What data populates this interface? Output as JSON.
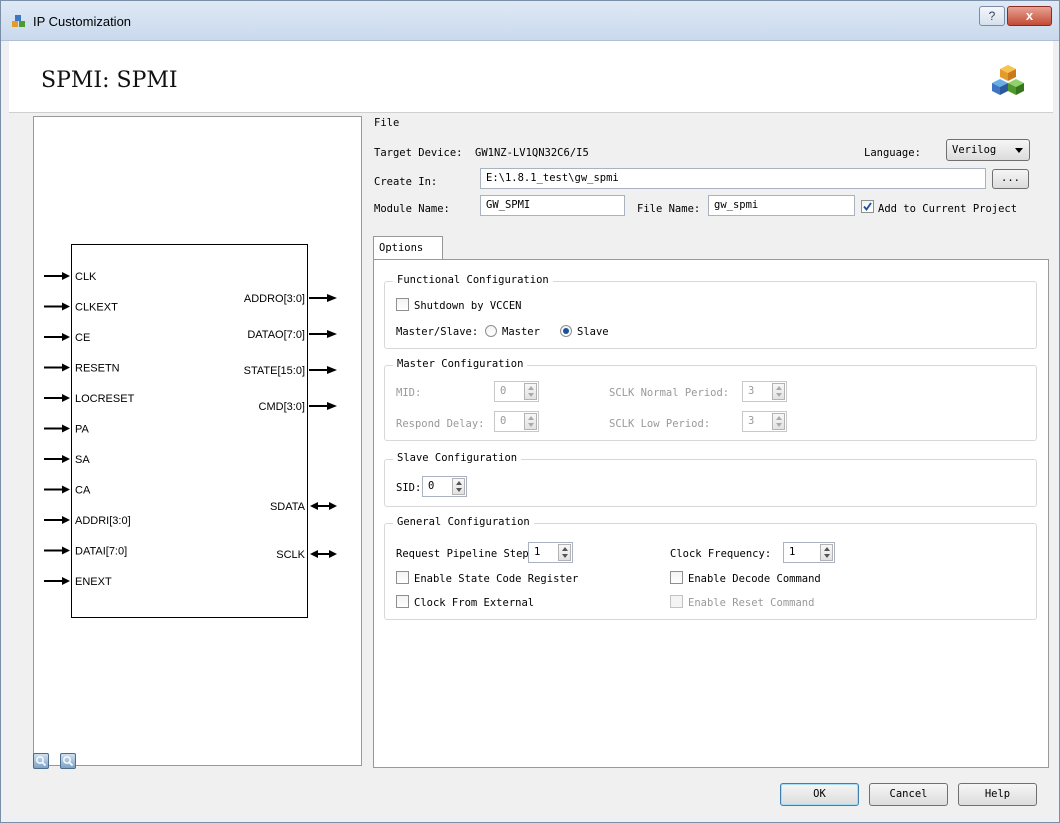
{
  "window": {
    "title": "IP Customization",
    "help_label": "?",
    "close_label": "x"
  },
  "header": {
    "title": "SPMI: SPMI"
  },
  "symbol": {
    "inputs": [
      "CLK",
      "CLKEXT",
      "CE",
      "RESETN",
      "LOCRESET",
      "PA",
      "SA",
      "CA",
      "ADDRI[3:0]",
      "DATAI[7:0]",
      "ENEXT"
    ],
    "outputs": [
      "ADDRO[3:0]",
      "DATAO[7:0]",
      "STATE[15:0]",
      "CMD[3:0]"
    ],
    "bidir": [
      "SDATA",
      "SCLK"
    ]
  },
  "file": {
    "section_label": "File",
    "target_device_label": "Target Device:",
    "target_device_value": "GW1NZ-LV1QN32C6/I5",
    "language_label": "Language:",
    "language_value": "Verilog",
    "create_in_label": "Create In:",
    "create_in_value": "E:\\1.8.1_test\\gw_spmi",
    "browse_label": "...",
    "module_name_label": "Module Name:",
    "module_name_value": "GW_SPMI",
    "file_name_label": "File Name:",
    "file_name_value": "gw_spmi",
    "add_project_label": "Add to Current Project",
    "add_project_checked": true
  },
  "options": {
    "tab_label": "Options",
    "functional": {
      "title": "Functional Configuration",
      "shutdown_label": "Shutdown by VCCEN",
      "shutdown_checked": false,
      "master_slave_label": "Master/Slave:",
      "master_label": "Master",
      "slave_label": "Slave",
      "selected": "Slave"
    },
    "master_config": {
      "title": "Master Configuration",
      "mid_label": "MID:",
      "mid_value": "0",
      "respond_delay_label": "Respond Delay:",
      "respond_delay_value": "0",
      "sclk_normal_label": "SCLK Normal Period:",
      "sclk_normal_value": "3",
      "sclk_low_label": "SCLK Low Period:",
      "sclk_low_value": "3"
    },
    "slave_config": {
      "title": "Slave Configuration",
      "sid_label": "SID:",
      "sid_value": "0"
    },
    "general": {
      "title": "General Configuration",
      "pipeline_label": "Request Pipeline Steps:",
      "pipeline_value": "1",
      "clock_freq_label": "Clock Frequency:",
      "clock_freq_value": "1",
      "state_code_label": "Enable State Code Register",
      "decode_cmd_label": "Enable Decode Command",
      "clock_ext_label": "Clock From External",
      "reset_cmd_label": "Enable Reset Command"
    }
  },
  "footer": {
    "ok_label": "OK",
    "cancel_label": "Cancel",
    "help_label": "Help"
  },
  "colors": {
    "accent": "#1b4fa0",
    "title_bar": "#c9d9ec",
    "disabled_text": "#999999"
  }
}
